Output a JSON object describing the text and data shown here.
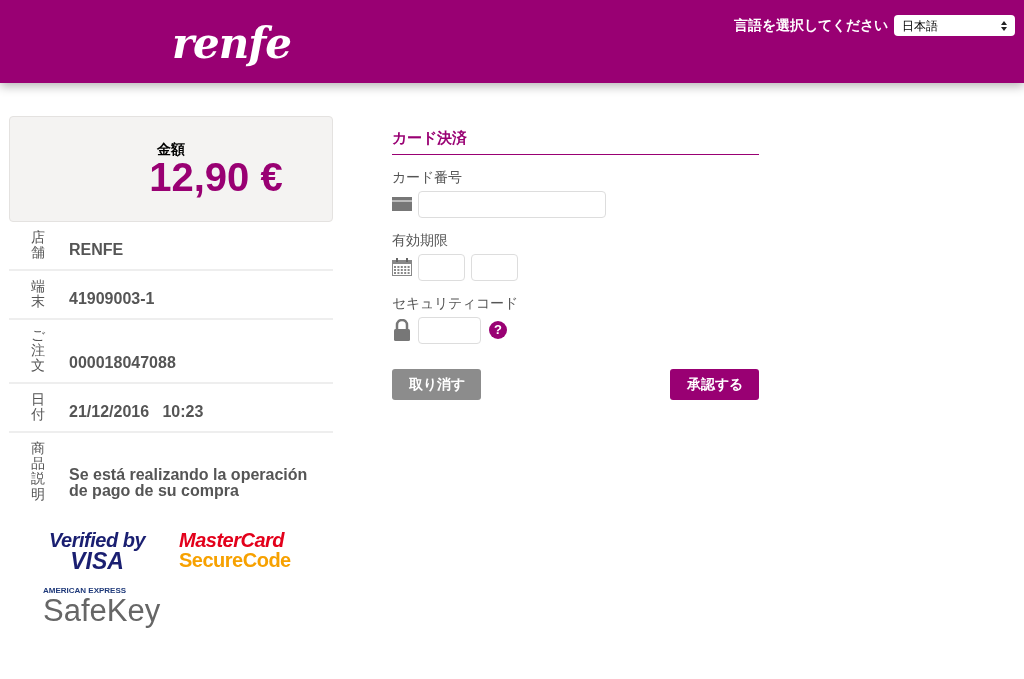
{
  "header": {
    "logo": "renfe",
    "language_label": "言語を選択してください",
    "language_value": "日本語"
  },
  "amount": {
    "label": "金額",
    "value": "12,90 €"
  },
  "details": [
    {
      "label": "店舗",
      "value": "RENFE"
    },
    {
      "label": "端末",
      "value": "41909003-1"
    },
    {
      "label": "ご注文",
      "value": "000018047088"
    },
    {
      "label": "日付",
      "value": "21/12/2016   10:23"
    },
    {
      "label": "商品説明",
      "value": "Se está realizando la operación de pago de su compra"
    }
  ],
  "secure_logos": {
    "visa": {
      "top": "Verified by",
      "bottom": "VISA"
    },
    "mastercard": {
      "top": "MasterCard",
      "bottom": "SecureCode"
    },
    "amex": {
      "top": "AMERICAN EXPRESS",
      "bottom": "SafeKey"
    }
  },
  "form": {
    "title": "カード決済",
    "fields": [
      {
        "kind": "card",
        "label": "カード番号"
      },
      {
        "kind": "expiry",
        "label": "有効期限"
      },
      {
        "kind": "cvv",
        "label": "セキュリティコード",
        "help": "?"
      }
    ],
    "buttons": [
      {
        "kind": "cancel",
        "label": "取り消す"
      },
      {
        "kind": "confirm",
        "label": "承認する"
      }
    ]
  }
}
